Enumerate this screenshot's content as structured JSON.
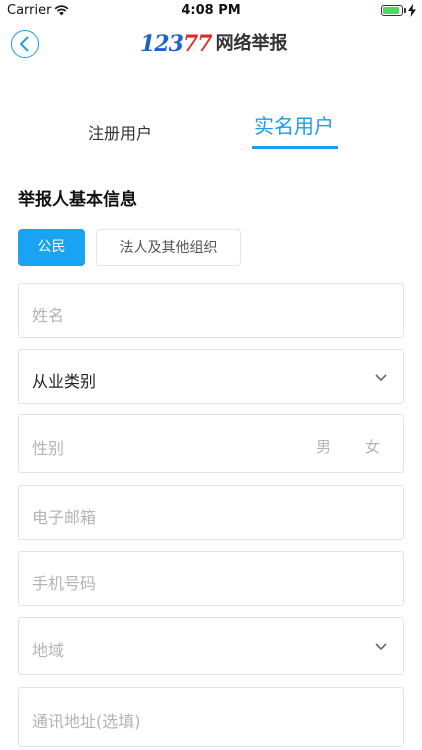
{
  "status_bar": {
    "carrier": "Carrier",
    "time": "4:08 PM"
  },
  "header": {
    "logo_number": "12377",
    "logo_text": "网络举报"
  },
  "tabs": [
    {
      "label": "注册用户",
      "active": false
    },
    {
      "label": "实名用户",
      "active": true
    }
  ],
  "section_title": "举报人基本信息",
  "user_type": {
    "options": [
      "公民",
      "法人及其他组织"
    ],
    "selected": "公民"
  },
  "form": {
    "name": {
      "placeholder": "姓名"
    },
    "occupation": {
      "value": "从业类别"
    },
    "gender": {
      "placeholder": "性别",
      "options": [
        "男",
        "女"
      ]
    },
    "email": {
      "placeholder": "电子邮箱"
    },
    "phone": {
      "placeholder": "手机号码"
    },
    "region": {
      "placeholder": "地域"
    },
    "address": {
      "placeholder": "通讯地址(选填)"
    }
  },
  "colors": {
    "accent": "#1a9fe8",
    "logo_blue": "#1d63c4",
    "logo_red": "#e02a2a"
  }
}
